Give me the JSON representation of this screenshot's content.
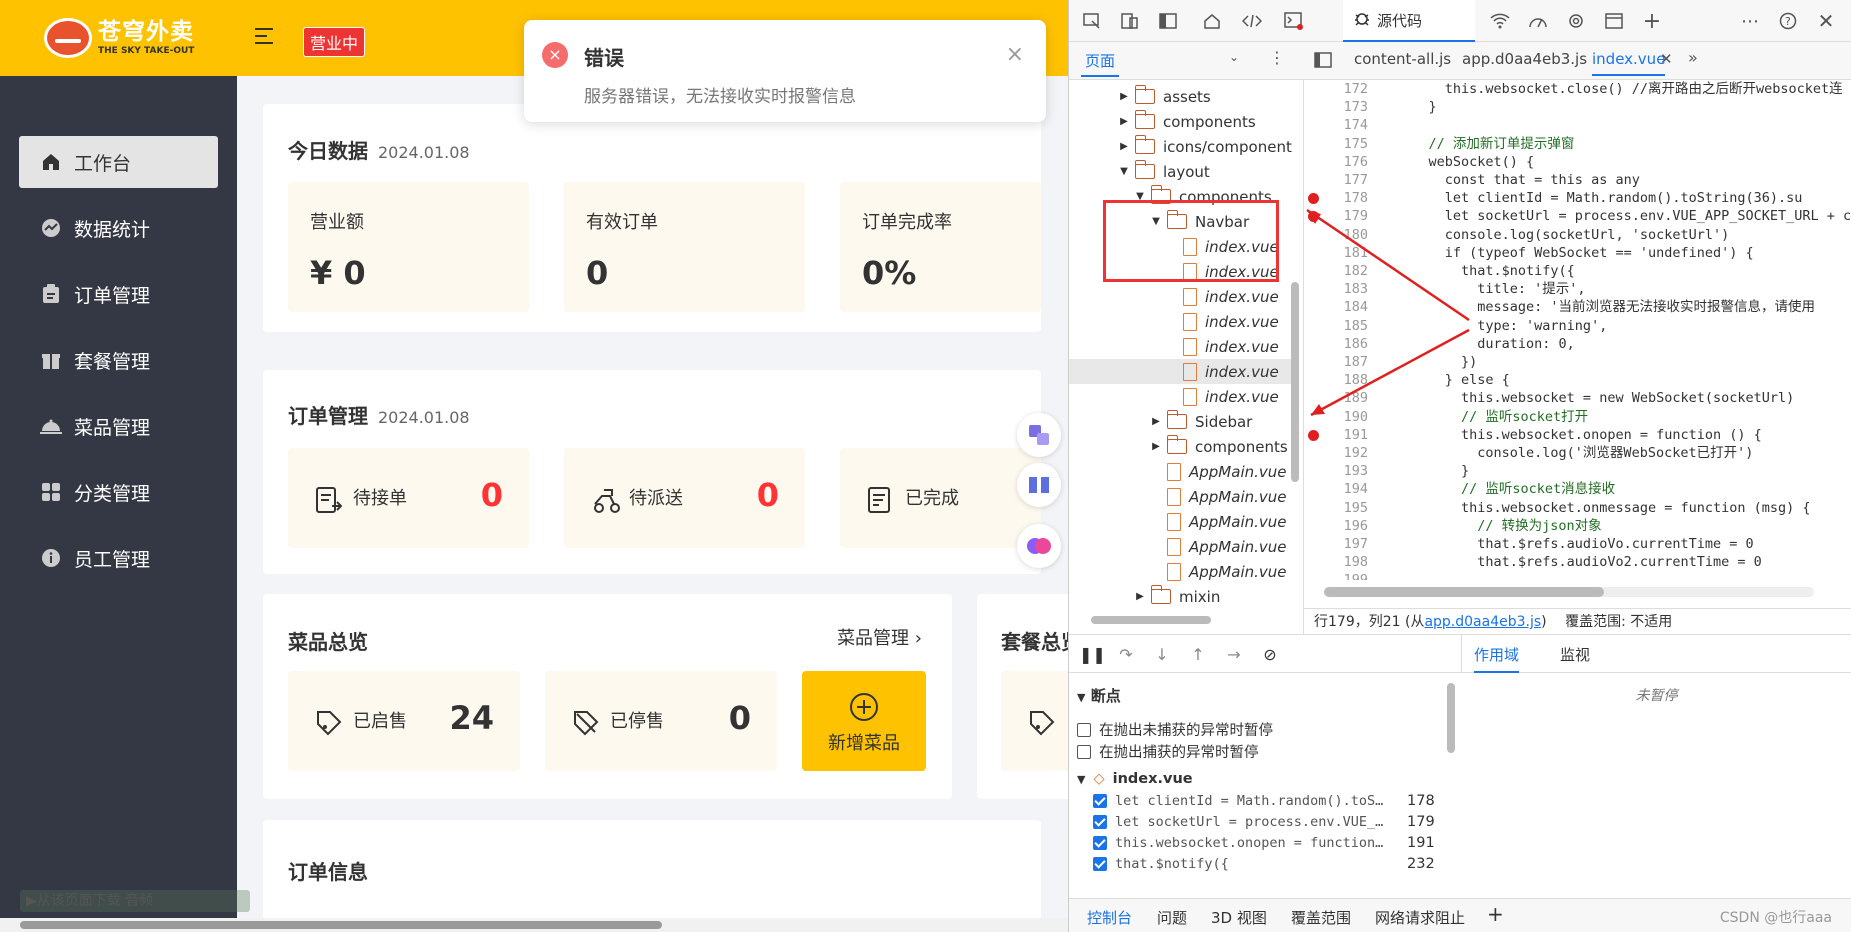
{
  "app": {
    "logo_cn": "苍穹外卖",
    "logo_en": "THE SKY TAKE-OUT",
    "status_badge": "营业中",
    "sidebar": [
      {
        "label": "工作台",
        "icon": "home-icon",
        "active": true
      },
      {
        "label": "数据统计",
        "icon": "chart-icon",
        "active": false
      },
      {
        "label": "订单管理",
        "icon": "clipboard-icon",
        "active": false
      },
      {
        "label": "套餐管理",
        "icon": "gift-icon",
        "active": false
      },
      {
        "label": "菜品管理",
        "icon": "cloche-icon",
        "active": false
      },
      {
        "label": "分类管理",
        "icon": "grid-icon",
        "active": false
      },
      {
        "label": "员工管理",
        "icon": "info-icon",
        "active": false
      }
    ],
    "today": {
      "title": "今日数据",
      "date": "2024.01.08",
      "tiles": [
        {
          "label": "营业额",
          "value": "¥ 0"
        },
        {
          "label": "有效订单",
          "value": "0"
        },
        {
          "label": "订单完成率",
          "value": "0%"
        }
      ]
    },
    "orders": {
      "title": "订单管理",
      "date": "2024.01.08",
      "tiles": [
        {
          "label": "待接单",
          "value": "0"
        },
        {
          "label": "待派送",
          "value": "0"
        },
        {
          "label": "已完成",
          "value": ""
        }
      ]
    },
    "dishes": {
      "title": "菜品总览",
      "link": "菜品管理",
      "on_sale_label": "已启售",
      "on_sale_value": "24",
      "off_sale_label": "已停售",
      "off_sale_value": "0",
      "add_label": "新增菜品"
    },
    "setmeal_title": "套餐总览",
    "order_info_title": "订单信息",
    "toast": {
      "title": "错误",
      "message": "服务器错误，无法接收实时报警信息"
    },
    "media_bar": "▶从该页面下载 音频"
  },
  "devtools": {
    "sources_tab": "源代码",
    "nav_tab": "页面",
    "editor_tabs": [
      "content-all.js",
      "app.d0aa4eb3.js",
      "index.vue"
    ],
    "active_editor_tab": "index.vue",
    "tree": [
      {
        "name": "assets",
        "type": "folder",
        "depth": 0,
        "arrow": "▶"
      },
      {
        "name": "components",
        "type": "folder",
        "depth": 0,
        "arrow": "▶"
      },
      {
        "name": "icons/component",
        "type": "folder",
        "depth": 0,
        "arrow": "▶"
      },
      {
        "name": "layout",
        "type": "folder",
        "depth": 0,
        "arrow": "▼"
      },
      {
        "name": "components",
        "type": "folder",
        "depth": 1,
        "arrow": "▼"
      },
      {
        "name": "Navbar",
        "type": "folder",
        "depth": 2,
        "arrow": "▼"
      },
      {
        "name": "index.vue",
        "type": "file",
        "depth": 3
      },
      {
        "name": "index.vue",
        "type": "file",
        "depth": 3
      },
      {
        "name": "index.vue",
        "type": "file",
        "depth": 3
      },
      {
        "name": "index.vue",
        "type": "file",
        "depth": 3
      },
      {
        "name": "index.vue",
        "type": "file",
        "depth": 3
      },
      {
        "name": "index.vue",
        "type": "file",
        "depth": 3,
        "selected": true
      },
      {
        "name": "index.vue",
        "type": "file",
        "depth": 3
      },
      {
        "name": "Sidebar",
        "type": "folder",
        "depth": 2,
        "arrow": "▶"
      },
      {
        "name": "components",
        "type": "folder",
        "depth": 2,
        "arrow": "▶"
      },
      {
        "name": "AppMain.vue",
        "type": "file",
        "depth": 2
      },
      {
        "name": "AppMain.vue",
        "type": "file",
        "depth": 2
      },
      {
        "name": "AppMain.vue",
        "type": "file",
        "depth": 2
      },
      {
        "name": "AppMain.vue",
        "type": "file",
        "depth": 2
      },
      {
        "name": "AppMain.vue",
        "type": "file",
        "depth": 2
      },
      {
        "name": "mixin",
        "type": "folder",
        "depth": 1,
        "arrow": "▶"
      }
    ],
    "code_lines": [
      {
        "n": "172",
        "t": "      this.websocket.close() //离开路由之后断开websocket连"
      },
      {
        "n": "173",
        "t": "    }"
      },
      {
        "n": "174",
        "t": ""
      },
      {
        "n": "175",
        "t": "    // 添加新订单提示弹窗"
      },
      {
        "n": "176",
        "t": "    webSocket() {"
      },
      {
        "n": "177",
        "t": "      const that = this as any"
      },
      {
        "n": "178",
        "t": "      let clientId = Math.random().toString(36).su",
        "bp": true
      },
      {
        "n": "179",
        "t": "      let socketUrl = process.env.VUE_APP_SOCKET_URL + cl",
        "bp": true
      },
      {
        "n": "180",
        "t": "      console.log(socketUrl, 'socketUrl')"
      },
      {
        "n": "181",
        "t": "      if (typeof WebSocket == 'undefined') {"
      },
      {
        "n": "182",
        "t": "        that.$notify({"
      },
      {
        "n": "183",
        "t": "          title: '提示',"
      },
      {
        "n": "184",
        "t": "          message: '当前浏览器无法接收实时报警信息，请使用"
      },
      {
        "n": "185",
        "t": "          type: 'warning',"
      },
      {
        "n": "186",
        "t": "          duration: 0,"
      },
      {
        "n": "187",
        "t": "        })"
      },
      {
        "n": "188",
        "t": "      } else {"
      },
      {
        "n": "189",
        "t": "        this.websocket = new WebSocket(socketUrl)"
      },
      {
        "n": "190",
        "t": "        // 监听socket打开"
      },
      {
        "n": "191",
        "t": "        this.websocket.onopen = function () {",
        "bp": true
      },
      {
        "n": "192",
        "t": "          console.log('浏览器WebSocket已打开')"
      },
      {
        "n": "193",
        "t": "        }"
      },
      {
        "n": "194",
        "t": "        // 监听socket消息接收"
      },
      {
        "n": "195",
        "t": "        this.websocket.onmessage = function (msg) {"
      },
      {
        "n": "196",
        "t": "          // 转换为json对象"
      },
      {
        "n": "197",
        "t": "          that.$refs.audioVo.currentTime = 0"
      },
      {
        "n": "198",
        "t": "          that.$refs.audioVo2.currentTime = 0"
      },
      {
        "n": "199",
        "t": ""
      }
    ],
    "status_prefix": "行179，列21 (从",
    "status_link": "app.d0aa4eb3.js",
    "status_suffix": ")",
    "coverage": "覆盖范围: 不适用",
    "breakpoints_title": "断点",
    "pause_uncaught": "在抛出未捕获的异常时暂停",
    "pause_caught": "在抛出捕获的异常时暂停",
    "bp_file": "index.vue",
    "breakpoints": [
      {
        "code": "let clientId = Math.random().toS…",
        "line": "178"
      },
      {
        "code": "let socketUrl = process.env.VUE_…",
        "line": "179"
      },
      {
        "code": "this.websocket.onopen = function…",
        "line": "191"
      },
      {
        "code": "that.$notify({",
        "line": "232"
      }
    ],
    "scope_tab": "作用域",
    "watch_tab": "监视",
    "not_paused": "未暂停",
    "drawer_tabs": [
      "控制台",
      "问题",
      "3D 视图",
      "覆盖范围",
      "网络请求阻止"
    ],
    "watermark": "CSDN @也行aaa"
  }
}
